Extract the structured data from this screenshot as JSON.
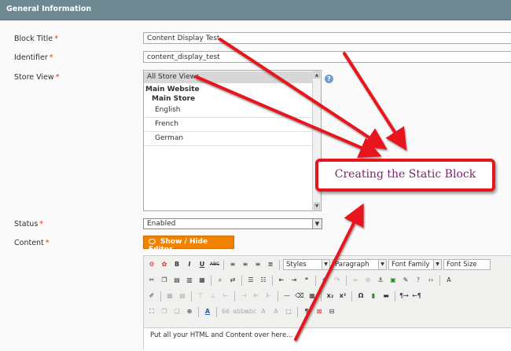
{
  "section": {
    "title": "General Information"
  },
  "form": {
    "block_title": {
      "label": "Block Title",
      "required_mark": "*",
      "value": "Content Display Test"
    },
    "identifier": {
      "label": "Identifier",
      "required_mark": "*",
      "value": "content_display_test"
    },
    "store_view": {
      "label": "Store View",
      "required_mark": "*",
      "options": {
        "all": "All Store Views",
        "website": "Main Website",
        "store": "Main Store",
        "languages": [
          "English",
          "French",
          "German"
        ]
      },
      "selected": "All Store Views"
    },
    "status": {
      "label": "Status",
      "required_mark": "*",
      "value": "Enabled"
    },
    "content": {
      "label": "Content",
      "required_mark": "*",
      "toggle_label": "Show / Hide Editor"
    }
  },
  "editor": {
    "dropdowns": {
      "styles": "Styles",
      "format": "Paragraph",
      "font_family": "Font Family",
      "font_size": "Font Size"
    },
    "content_text": "Put all your HTML and Content over here..."
  },
  "annotation": {
    "callout_text": "Creating the Static Block",
    "color": "#e8141e"
  }
}
